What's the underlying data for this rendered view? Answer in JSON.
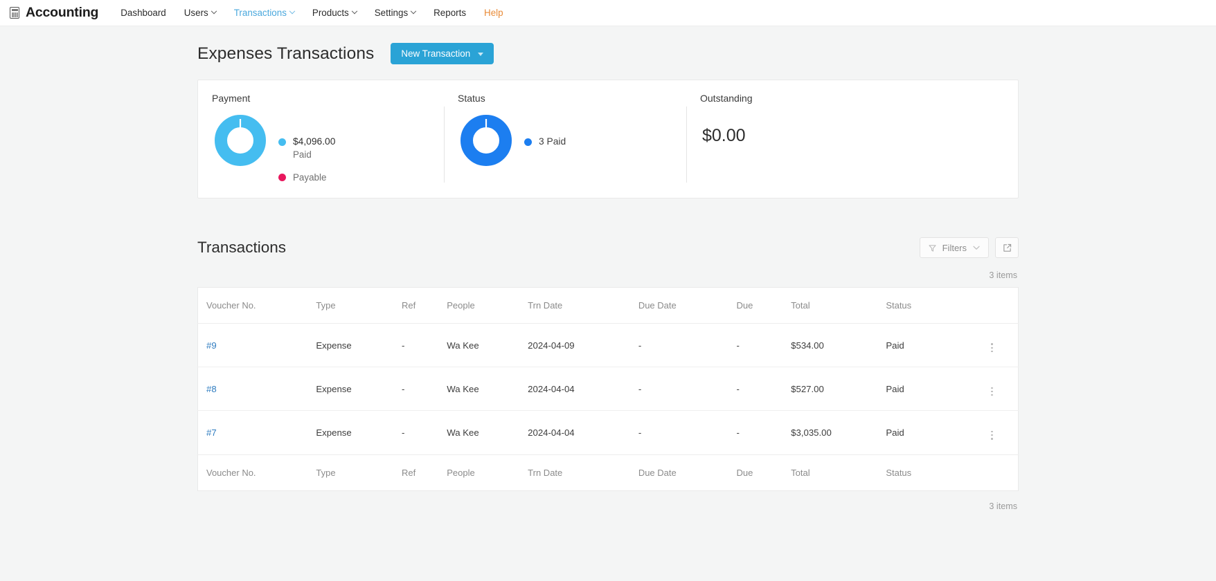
{
  "navbar": {
    "brand": "Accounting",
    "brand_icon": "calculator-icon",
    "items": [
      {
        "label": "Dashboard",
        "dropdown": false,
        "state": "default"
      },
      {
        "label": "Users",
        "dropdown": true,
        "state": "default"
      },
      {
        "label": "Transactions",
        "dropdown": true,
        "state": "active"
      },
      {
        "label": "Products",
        "dropdown": true,
        "state": "default"
      },
      {
        "label": "Settings",
        "dropdown": true,
        "state": "default"
      },
      {
        "label": "Reports",
        "dropdown": false,
        "state": "default"
      },
      {
        "label": "Help",
        "dropdown": false,
        "state": "help"
      }
    ]
  },
  "page": {
    "title": "Expenses Transactions",
    "new_transaction_label": "New Transaction"
  },
  "summary": {
    "payment": {
      "title": "Payment",
      "legend": [
        {
          "value": "$4,096.00",
          "label": "Paid",
          "color": "#45bdf0"
        },
        {
          "value": "",
          "label": "Payable",
          "color": "#e8175d"
        }
      ]
    },
    "status": {
      "title": "Status",
      "legend": [
        {
          "label": "3 Paid",
          "color": "#1c7ef0"
        }
      ]
    },
    "outstanding": {
      "title": "Outstanding",
      "value": "$0.00"
    }
  },
  "chart_data": [
    {
      "type": "pie",
      "title": "Payment",
      "categories": [
        "Paid",
        "Payable"
      ],
      "values": [
        4096.0,
        0
      ],
      "labels": [
        "$4,096.00",
        ""
      ],
      "colors": [
        "#45bdf0",
        "#e8175d"
      ],
      "donut": true,
      "legend_position": "right"
    },
    {
      "type": "pie",
      "title": "Status",
      "categories": [
        "Paid"
      ],
      "values": [
        3
      ],
      "labels": [
        "3 Paid"
      ],
      "colors": [
        "#1c7ef0"
      ],
      "donut": true,
      "legend_position": "right"
    }
  ],
  "transactions": {
    "section_title": "Transactions",
    "filters_label": "Filters",
    "export_icon": "external-link-icon",
    "items_count_top": "3 items",
    "items_count_bottom": "3 items",
    "columns": [
      "Voucher No.",
      "Type",
      "Ref",
      "People",
      "Trn Date",
      "Due Date",
      "Due",
      "Total",
      "Status"
    ],
    "rows": [
      {
        "voucher": "#9",
        "type": "Expense",
        "ref": "-",
        "people": "Wa Kee",
        "trn_date": "2024-04-09",
        "due_date": "-",
        "due": "-",
        "total": "$534.00",
        "status": "Paid"
      },
      {
        "voucher": "#8",
        "type": "Expense",
        "ref": "-",
        "people": "Wa Kee",
        "trn_date": "2024-04-04",
        "due_date": "-",
        "due": "-",
        "total": "$527.00",
        "status": "Paid"
      },
      {
        "voucher": "#7",
        "type": "Expense",
        "ref": "-",
        "people": "Wa Kee",
        "trn_date": "2024-04-04",
        "due_date": "-",
        "due": "-",
        "total": "$3,035.00",
        "status": "Paid"
      }
    ]
  },
  "colors": {
    "primary_button": "#2aa3d6",
    "nav_active": "#4aa8dd",
    "nav_help": "#e98b38",
    "link": "#2f7cc0",
    "page_bg": "#f4f5f5"
  }
}
